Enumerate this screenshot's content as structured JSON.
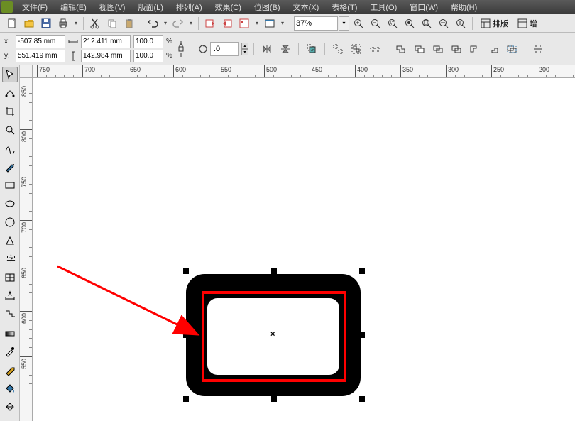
{
  "menus": {
    "file": {
      "label": "文件",
      "acc": "F"
    },
    "edit": {
      "label": "编辑",
      "acc": "E"
    },
    "view": {
      "label": "视图",
      "acc": "V"
    },
    "layout": {
      "label": "版面",
      "acc": "L"
    },
    "arrange": {
      "label": "排列",
      "acc": "A"
    },
    "effects": {
      "label": "效果",
      "acc": "C"
    },
    "bitmap": {
      "label": "位图",
      "acc": "B"
    },
    "text": {
      "label": "文本",
      "acc": "X"
    },
    "table": {
      "label": "表格",
      "acc": "T"
    },
    "tools": {
      "label": "工具",
      "acc": "O"
    },
    "window": {
      "label": "窗口",
      "acc": "W"
    },
    "help": {
      "label": "帮助",
      "acc": "H"
    }
  },
  "zoom": {
    "value": "37%"
  },
  "layout_btn": {
    "label": "排版"
  },
  "enhance_btn": {
    "label": "增"
  },
  "position": {
    "x_label": "x:",
    "x_value": "-507.85 mm",
    "y_label": "y:",
    "y_value": "551.419 mm"
  },
  "size": {
    "w_value": "212.411 mm",
    "h_value": "142.984 mm"
  },
  "scale": {
    "sx_value": "100.0",
    "sx_suffix": "%",
    "sy_value": "100.0",
    "sy_suffix": "%"
  },
  "rotation": {
    "value": ".0"
  },
  "ruler_h": [
    {
      "px": 6,
      "label": "750"
    },
    {
      "px": 70,
      "label": "700"
    },
    {
      "px": 134,
      "label": "650"
    },
    {
      "px": 198,
      "label": "600"
    },
    {
      "px": 262,
      "label": "550"
    },
    {
      "px": 326,
      "label": "500"
    },
    {
      "px": 390,
      "label": "450"
    },
    {
      "px": 454,
      "label": "400"
    },
    {
      "px": 518,
      "label": "350"
    },
    {
      "px": 582,
      "label": "300"
    },
    {
      "px": 646,
      "label": "250"
    },
    {
      "px": 710,
      "label": "200"
    }
  ],
  "ruler_v": [
    {
      "px": 8,
      "label": "850"
    },
    {
      "px": 72,
      "label": "800"
    },
    {
      "px": 136,
      "label": "750"
    },
    {
      "px": 200,
      "label": "700"
    },
    {
      "px": 264,
      "label": "650"
    },
    {
      "px": 328,
      "label": "600"
    },
    {
      "px": 392,
      "label": "550"
    }
  ]
}
